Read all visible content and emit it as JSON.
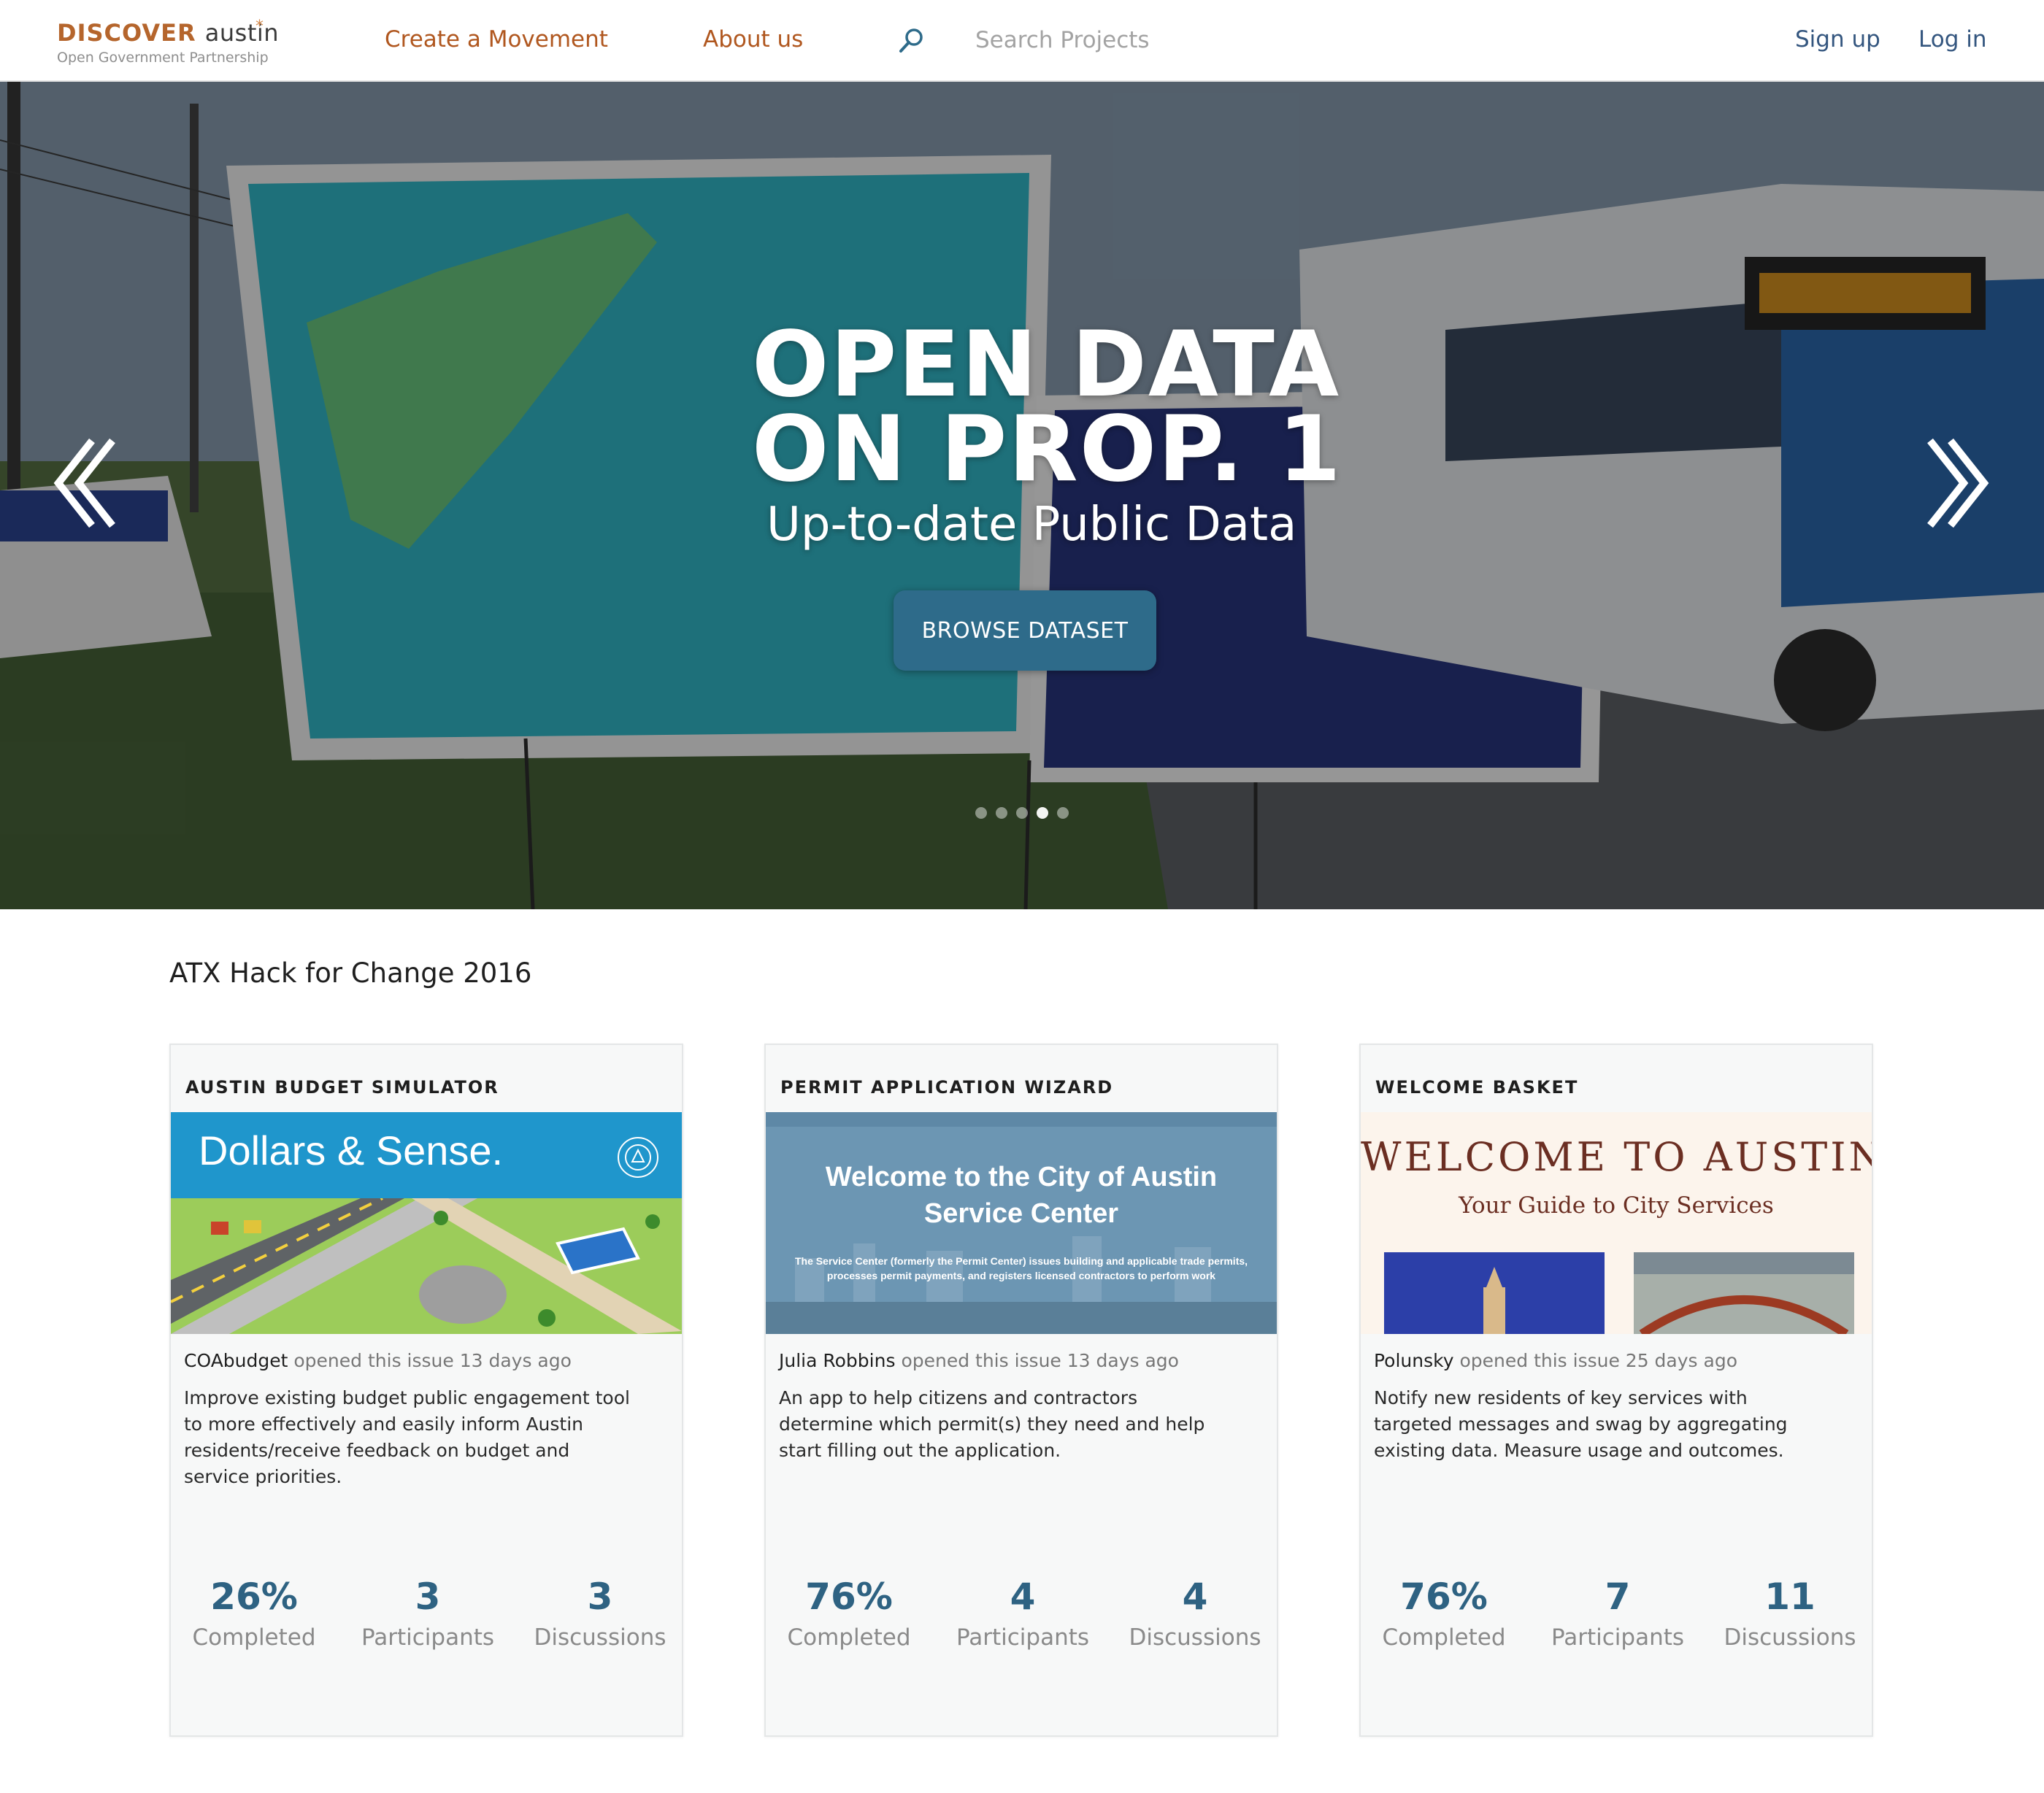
{
  "nav": {
    "logo_primary": "DISCOVER",
    "logo_city": "austin",
    "logo_subtitle": "Open Government Partnership",
    "links": [
      "Create a Movement",
      "About us"
    ],
    "search_placeholder": "Search Projects",
    "signup": "Sign up",
    "login": "Log in",
    "accent_color": "#b0571f",
    "auth_color": "#34567f"
  },
  "hero": {
    "title_line1": "OPEN DATA",
    "title_line2": "ON PROP. 1",
    "subtitle": "Up-to-date Public Data",
    "button": "BROWSE DATASET",
    "button_color": "#2e6b8a",
    "slide_count": 5,
    "active_slide": 4,
    "prev_icon": "chevron-double-left-icon",
    "next_icon": "chevron-double-right-icon"
  },
  "section": {
    "title": "ATX Hack for Change 2016"
  },
  "cards": [
    {
      "title": "AUSTIN BUDGET SIMULATOR",
      "image_text": "Dollars & Sense.",
      "user": "COAbudget",
      "opened": "opened this issue 13 days ago",
      "description": "Improve existing budget public engagement tool to more effectively and easily inform Austin residents/receive feedback on budget and service priorities.",
      "completed": "26%",
      "participants": "3",
      "discussions": "3"
    },
    {
      "title": "PERMIT APPLICATION WIZARD",
      "image_heading_1": "Welcome to the City of Austin",
      "image_heading_2": "Service Center",
      "image_caption_1": "The Service Center (formerly the Permit Center) issues building and applicable trade permits,",
      "image_caption_2": "processes permit payments, and registers licensed contractors to perform work",
      "user": "Julia Robbins",
      "opened": "opened this issue 13 days ago",
      "description": "An app to help citizens and contractors determine which permit(s) they need and help start filling out the application.",
      "completed": "76%",
      "participants": "4",
      "discussions": "4"
    },
    {
      "title": "WELCOME BASKET",
      "image_heading": "WELCOME TO AUSTIN",
      "image_subheading": "Your Guide to City Services",
      "user": "Polunsky",
      "opened": "opened this issue 25 days ago",
      "description": "Notify new residents of key services with targeted messages and swag by aggregating existing data. Measure usage and outcomes.",
      "completed": "76%",
      "participants": "7",
      "discussions": "11"
    }
  ],
  "stat_labels": {
    "completed": "Completed",
    "participants": "Participants",
    "discussions": "Discussions"
  },
  "stat_color": "#2e6282"
}
